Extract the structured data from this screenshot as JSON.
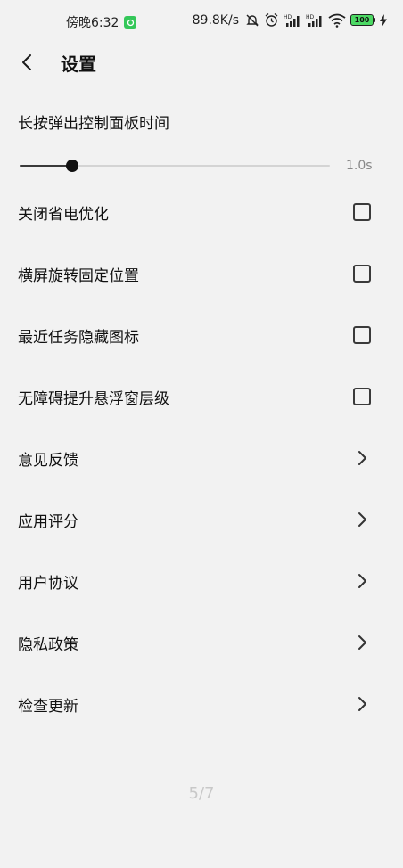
{
  "status_bar": {
    "time": "傍晚6:32",
    "network_speed": "89.8K/s",
    "battery_level": "100",
    "icons": [
      "app-notification-icon",
      "mute-bell-icon",
      "alarm-icon",
      "hd-signal-icon",
      "hd-signal-icon",
      "wifi-icon",
      "battery-icon",
      "charging-icon"
    ]
  },
  "header": {
    "title": "设置",
    "back_icon": "chevron-left-icon"
  },
  "slider_setting": {
    "label": "长按弹出控制面板时间",
    "value_text": "1.0s",
    "fill_fraction": 0.17
  },
  "toggles": [
    {
      "label": "关闭省电优化",
      "checked": false
    },
    {
      "label": "横屏旋转固定位置",
      "checked": false
    },
    {
      "label": "最近任务隐藏图标",
      "checked": false
    },
    {
      "label": "无障碍提升悬浮窗层级",
      "checked": false
    }
  ],
  "links": [
    {
      "label": "意见反馈"
    },
    {
      "label": "应用评分"
    },
    {
      "label": "用户协议"
    },
    {
      "label": "隐私政策"
    },
    {
      "label": "检查更新"
    }
  ],
  "page_indicator": "5/7",
  "colors": {
    "background": "#f2f2f2",
    "text": "#111111",
    "control": "#3a3a3a",
    "battery_fill": "#4cd964"
  }
}
